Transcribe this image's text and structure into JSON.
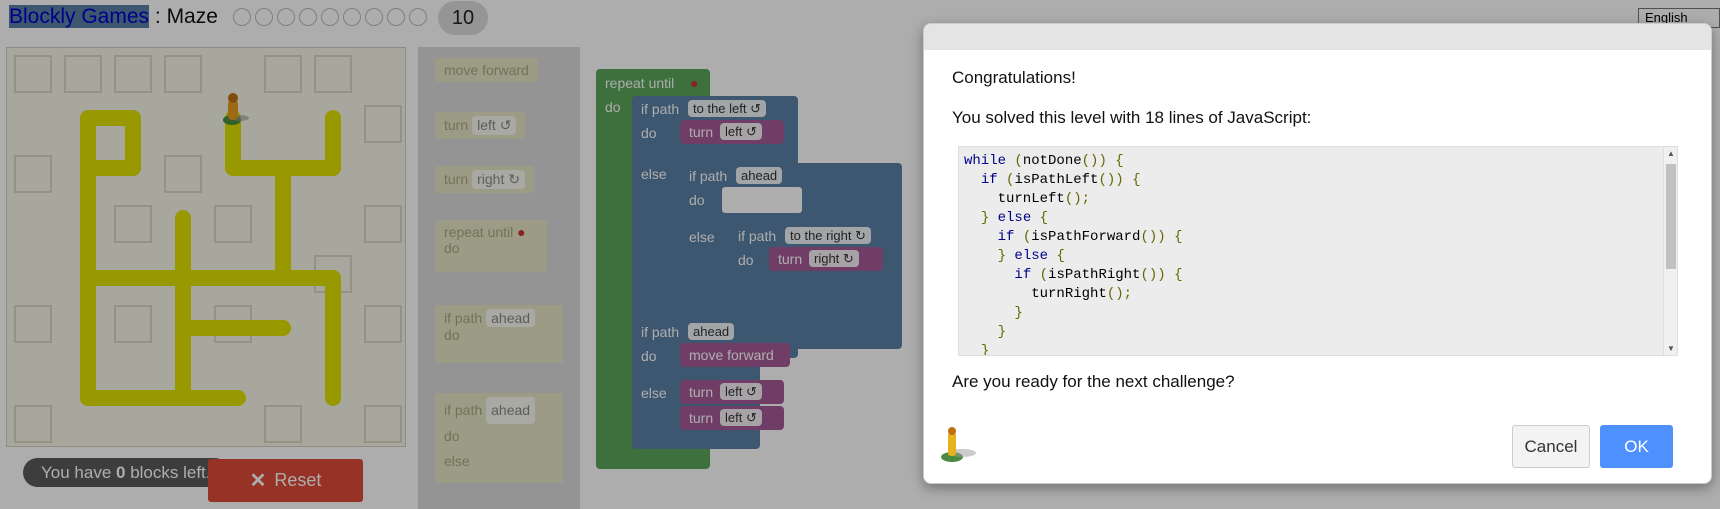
{
  "header": {
    "app_name": "Blockly Games",
    "separator": " : ",
    "game_name": "Maze",
    "current_level": "10",
    "language": "English"
  },
  "maze": {
    "capacity_prefix": "You have ",
    "capacity_count": "0",
    "capacity_suffix": " blocks left.",
    "reset_label": "Reset"
  },
  "toolbox": {
    "move_forward": "move forward",
    "turn": "turn",
    "left": "left ↺",
    "right": "right ↻",
    "repeat_until": "repeat until",
    "do": "do",
    "if_path": "if path",
    "ahead": "ahead",
    "else": "else"
  },
  "workspace": {
    "repeat_until": "repeat until",
    "do": "do",
    "else": "else",
    "if_path": "if path",
    "to_the_left": "to the left ↺",
    "ahead": "ahead",
    "to_the_right": "to the right ↻",
    "turn": "turn",
    "left": "left ↺",
    "right": "right ↻",
    "move_forward": "move forward"
  },
  "dialog": {
    "congrats": "Congratulations!",
    "solved": "You solved this level with 18 lines of JavaScript:",
    "code_lines": [
      "while (notDone()) {",
      "  if (isPathLeft()) {",
      "    turnLeft();",
      "  } else {",
      "    if (isPathForward()) {",
      "    } else {",
      "      if (isPathRight()) {",
      "        turnRight();",
      "      }",
      "    }",
      "  }"
    ],
    "next_prompt": "Are you ready for the next challenge?",
    "cancel_label": "Cancel",
    "ok_label": "OK"
  },
  "colors": {
    "path": "#e6e600",
    "loop_block": "#5ba55b",
    "logic_block": "#5b80a5",
    "movement_block": "#a55b99",
    "reset_button": "#dd4b39",
    "ok_button": "#4d90fe"
  }
}
